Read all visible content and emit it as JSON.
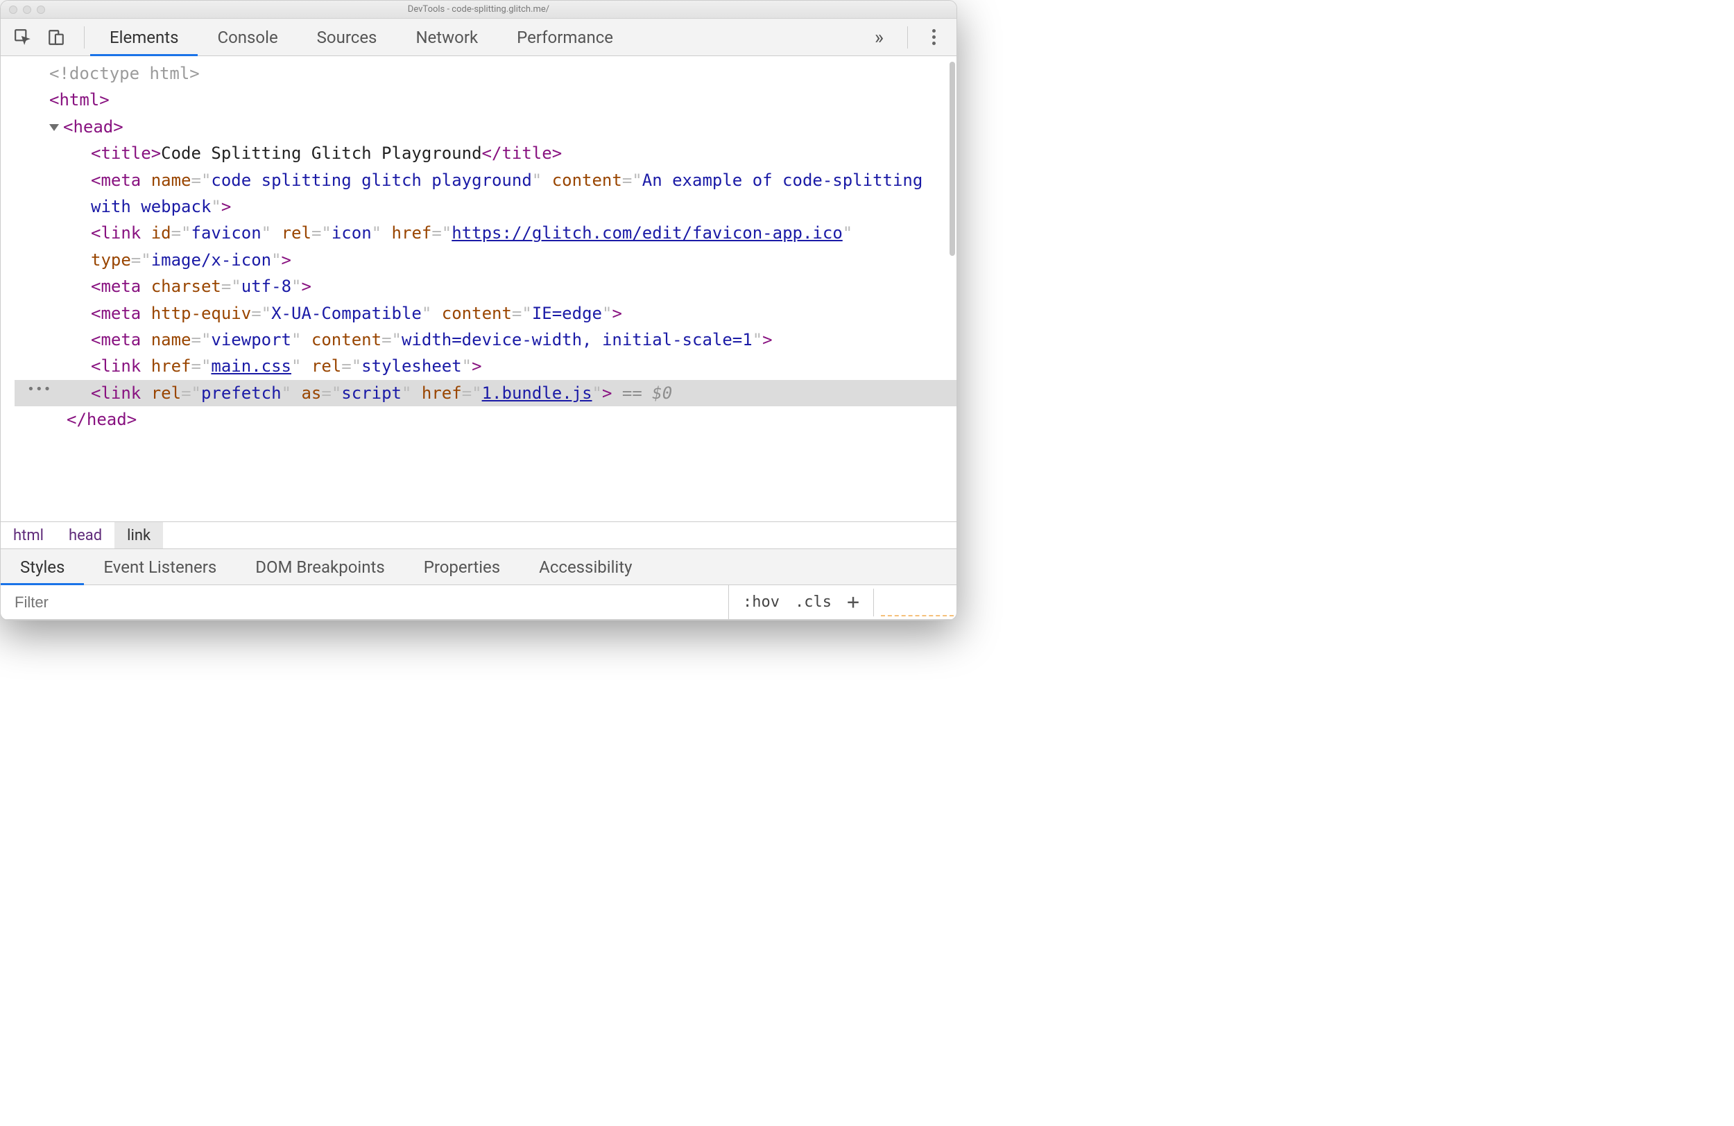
{
  "titlebar": {
    "title": "DevTools - code-splitting.glitch.me/"
  },
  "toolbar": {
    "tabs": [
      "Elements",
      "Console",
      "Sources",
      "Network",
      "Performance"
    ],
    "active_tab": "Elements",
    "more": "»"
  },
  "dom": {
    "doctype": "<!doctype html>",
    "html_open": "html",
    "head_open": "head",
    "title_tag": {
      "tag": "title",
      "text": "Code Splitting Glitch Playground"
    },
    "meta1": {
      "tag": "meta",
      "attrs": [
        {
          "n": "name",
          "v": "code splitting glitch playground"
        },
        {
          "n": "content",
          "v": "An example of code-splitting with webpack"
        }
      ]
    },
    "link1": {
      "tag": "link",
      "attrs": [
        {
          "n": "id",
          "v": "favicon"
        },
        {
          "n": "rel",
          "v": "icon"
        },
        {
          "n": "href",
          "v": "https://glitch.com/edit/favicon-app.ico",
          "link": true
        },
        {
          "n": "type",
          "v": "image/x-icon"
        }
      ]
    },
    "meta2": {
      "tag": "meta",
      "attrs": [
        {
          "n": "charset",
          "v": "utf-8"
        }
      ]
    },
    "meta3": {
      "tag": "meta",
      "attrs": [
        {
          "n": "http-equiv",
          "v": "X-UA-Compatible"
        },
        {
          "n": "content",
          "v": "IE=edge"
        }
      ]
    },
    "meta4": {
      "tag": "meta",
      "attrs": [
        {
          "n": "name",
          "v": "viewport"
        },
        {
          "n": "content",
          "v": "width=device-width, initial-scale=1"
        }
      ]
    },
    "link2": {
      "tag": "link",
      "attrs": [
        {
          "n": "href",
          "v": "main.css",
          "link": true
        },
        {
          "n": "rel",
          "v": "stylesheet"
        }
      ]
    },
    "link_selected": {
      "tag": "link",
      "attrs": [
        {
          "n": "rel",
          "v": "prefetch"
        },
        {
          "n": "as",
          "v": "script"
        },
        {
          "n": "href",
          "v": "1.bundle.js",
          "link": true
        }
      ],
      "suffix": " == $0"
    },
    "head_close": "head"
  },
  "breadcrumb": [
    "html",
    "head",
    "link"
  ],
  "styles_tabs": [
    "Styles",
    "Event Listeners",
    "DOM Breakpoints",
    "Properties",
    "Accessibility"
  ],
  "styles_active": "Styles",
  "filter": {
    "placeholder": "Filter",
    "hov": ":hov",
    "cls": ".cls"
  }
}
